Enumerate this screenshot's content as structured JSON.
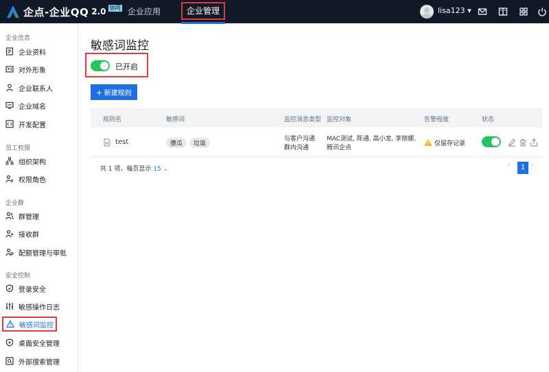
{
  "app": {
    "brand": "企点-企业QQ",
    "version": "2.0",
    "badge": "协同"
  },
  "topnav": {
    "items": [
      {
        "label": "企业应用"
      },
      {
        "label": "企业管理"
      }
    ],
    "active_index": 1
  },
  "user": {
    "name": "lisa123 ▾"
  },
  "sidebar": {
    "groups": [
      {
        "title": "企业信息",
        "items": [
          "企业资料",
          "对外形象",
          "企业联系人",
          "企业域名",
          "开发配置"
        ]
      },
      {
        "title": "员工权限",
        "items": [
          "组织架构",
          "权限角色"
        ]
      },
      {
        "title": "企业群",
        "items": [
          "群管理",
          "接收群",
          "配额管理与审批"
        ]
      },
      {
        "title": "安全控制",
        "items": [
          "登录安全",
          "敏感操作日志",
          "敏感词监控",
          "桌面安全管理",
          "外部搜索管理"
        ]
      }
    ],
    "active_item": "敏感词监控"
  },
  "main": {
    "title": "敏感词监控",
    "toggle_label": "已开启",
    "toggle_on": true,
    "new_button": "新建规则",
    "table": {
      "headers": [
        "规则名",
        "敏感词",
        "监控消息类型",
        "监控对象",
        "告警程度",
        "状态"
      ],
      "rows": [
        {
          "name": "test",
          "words": [
            "傻瓜",
            "垃圾"
          ],
          "msg_type_1": "与客户沟通",
          "msg_type_2": "群内沟通",
          "targets_1": "MAC测试, 陈通, 高小龙, 李丽娜,",
          "targets_2": "腾讯企点",
          "alert": "仅留存记录",
          "enabled": true
        }
      ]
    },
    "pagination": {
      "summary": "共 1 项，每页显示",
      "page_size": "15",
      "current_page": "1"
    }
  },
  "colors": {
    "topbar": "#111827",
    "accent": "#1e6fe0",
    "toggle_on": "#22c55e",
    "highlight_border": "#e53935",
    "warning": "#f5b400"
  }
}
